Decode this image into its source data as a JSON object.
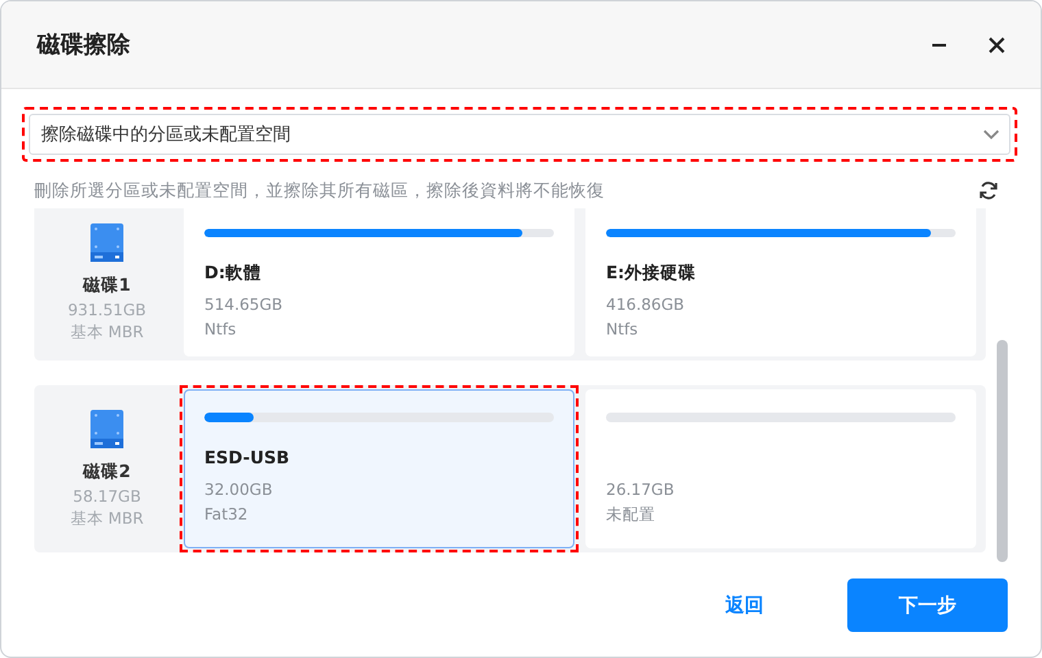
{
  "window": {
    "title": "磁碟擦除"
  },
  "dropdown": {
    "value": "擦除磁碟中的分區或未配置空間",
    "highlighted": true
  },
  "description": "刪除所選分區或未配置空間，並擦除其所有磁區，擦除後資料將不能恢復",
  "disks": [
    {
      "name": "磁碟1",
      "size": "931.51GB",
      "type": "基本 MBR",
      "partitions": [
        {
          "name": "D:軟體",
          "size": "514.65GB",
          "fs": "Ntfs",
          "level": 0.91,
          "selected": false,
          "highlighted": false
        },
        {
          "name": "E:外接硬碟",
          "size": "416.86GB",
          "fs": "Ntfs",
          "level": 0.93,
          "selected": false,
          "highlighted": false
        }
      ]
    },
    {
      "name": "磁碟2",
      "size": "58.17GB",
      "type": "基本 MBR",
      "partitions": [
        {
          "name": "ESD-USB",
          "size": "32.00GB",
          "fs": "Fat32",
          "level": 0.14,
          "selected": true,
          "highlighted": true
        },
        {
          "size": "26.17GB",
          "fs": "未配置",
          "selected": false,
          "highlighted": false
        }
      ]
    }
  ],
  "buttons": {
    "back": "返回",
    "next": "下一步"
  }
}
